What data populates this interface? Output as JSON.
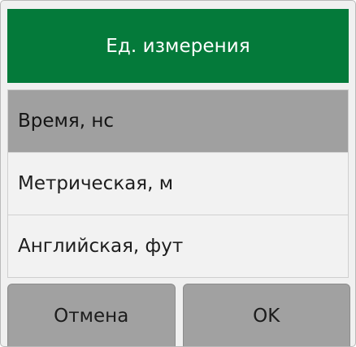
{
  "dialog": {
    "title": "Ед. измерения",
    "options": [
      {
        "label": "Время, нс",
        "selected": true
      },
      {
        "label": "Метрическая, м",
        "selected": false
      },
      {
        "label": "Английская, фут",
        "selected": false
      }
    ],
    "cancel_label": "Отмена",
    "ok_label": "OK"
  },
  "colors": {
    "accent": "#047a3a",
    "selected_row": "#a0a0a0",
    "button": "#a1a1a1"
  }
}
